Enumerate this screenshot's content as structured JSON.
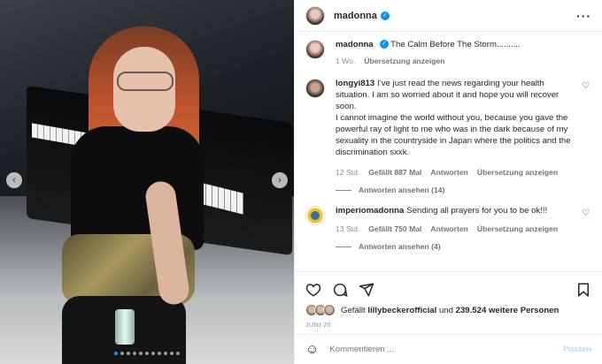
{
  "post": {
    "author": "madonna",
    "caption": "The Calm Before The Storm..........",
    "caption_time": "1 Wo.",
    "translate_label": "Übersetzung anzeigen",
    "dots_count": 11,
    "active_dot": 0
  },
  "header": {
    "username": "madonna",
    "more_icon": "more-horizontal-icon"
  },
  "comments": [
    {
      "username": "longyi813",
      "text": "I've just read the news regarding your health situation. I am so worried about it and hope you will recover soon.\nI cannot imagine the world without you, because you gave the powerful ray of light to me who was in the dark because of my sexuality in the countryside in Japan where the politics and the discrimination sxxk.",
      "time": "12 Std.",
      "likes": "Gefällt 887 Mal",
      "reply": "Antworten",
      "translate": "Übersetzung anzeigen",
      "replies_label": "Antworten ansehen (14)"
    },
    {
      "username": "imperiomadonna",
      "text": "Sending all prayers for you to be ok!!!",
      "time": "13 Std.",
      "likes": "Gefällt 750 Mal",
      "reply": "Antworten",
      "translate": "Übersetzung anzeigen",
      "replies_label": "Antworten ansehen (4)"
    }
  ],
  "likes": {
    "prefix": "Gefällt",
    "user": "lillybeckerofficial",
    "connector": "und",
    "others": "239.524 weitere Personen"
  },
  "date": "JUNI 20",
  "comment_box": {
    "placeholder": "Kommentieren ...",
    "post_label": "Posten"
  },
  "icons": {
    "like": "heart-icon",
    "comment": "comment-icon",
    "share": "share-icon",
    "save": "bookmark-icon",
    "emoji": "emoji-icon"
  },
  "colors": {
    "verified": "#0095f6",
    "post_button": "#b3dbff",
    "meta_text": "#8e8e8e"
  }
}
